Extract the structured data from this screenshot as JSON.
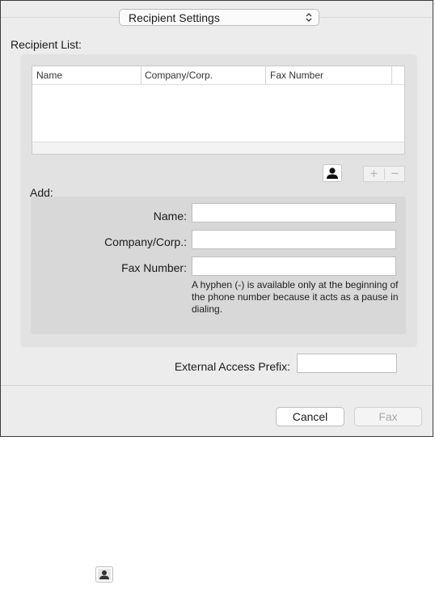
{
  "popup": {
    "label": "Recipient Settings",
    "icon": "up-down-chevron-icon"
  },
  "recipient_list": {
    "title": "Recipient List:",
    "columns": [
      "Name",
      "Company/Corp.",
      "Fax Number"
    ],
    "rows": []
  },
  "toolbar": {
    "address_book_icon": "person-icon",
    "add_symbol": "+",
    "remove_symbol": "−"
  },
  "add": {
    "title": "Add:",
    "name_label": "Name:",
    "name_value": "",
    "company_label": "Company/Corp.:",
    "company_value": "",
    "fax_label": "Fax Number:",
    "fax_value": "",
    "note": "A hyphen (-) is available only at the beginning of the phone number because it acts as a pause in dialing."
  },
  "external": {
    "label": "External Access Prefix:",
    "value": ""
  },
  "buttons": {
    "cancel": "Cancel",
    "fax": "Fax"
  },
  "footer_icon": "person-icon"
}
